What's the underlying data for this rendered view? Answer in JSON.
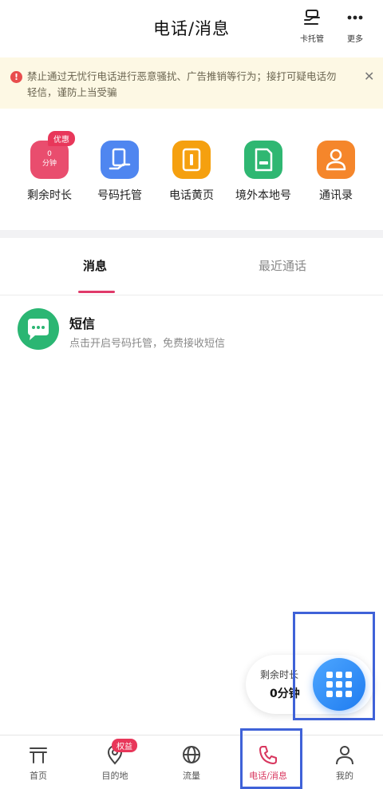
{
  "header": {
    "title": "电话/消息",
    "card_label": "卡托管",
    "more_label": "更多"
  },
  "notice": {
    "text": "禁止通过无忧行电话进行恶意骚扰、广告推销等行为；接打可疑电话勿轻信，谨防上当受骗"
  },
  "shortcuts": [
    {
      "label": "剩余时长",
      "badge": "优惠",
      "inner_l1": "0",
      "inner_l2": "分钟",
      "color": "#e94d6e"
    },
    {
      "label": "号码托管",
      "color": "#4f86f0"
    },
    {
      "label": "电话黄页",
      "color": "#f5a00f"
    },
    {
      "label": "境外本地号",
      "color": "#2fb772"
    },
    {
      "label": "通讯录",
      "color": "#f5862b"
    }
  ],
  "tabs": {
    "messages": "消息",
    "recent_calls": "最近通话"
  },
  "message_item": {
    "title": "短信",
    "subtitle": "点击开启号码托管，免费接收短信",
    "icon": "chat-icon"
  },
  "remaining": {
    "label": "剩余时长",
    "value": "0分钟"
  },
  "bottom_nav": [
    {
      "label": "首页",
      "icon": "home-icon"
    },
    {
      "label": "目的地",
      "icon": "location-icon",
      "badge": "权益"
    },
    {
      "label": "流量",
      "icon": "globe-icon"
    },
    {
      "label": "电话/消息",
      "icon": "phone-icon"
    },
    {
      "label": "我的",
      "icon": "user-icon"
    }
  ],
  "colors": {
    "accent": "#d8365e",
    "dial": "#2a8af5",
    "highlight_box": "#3f62d8"
  }
}
